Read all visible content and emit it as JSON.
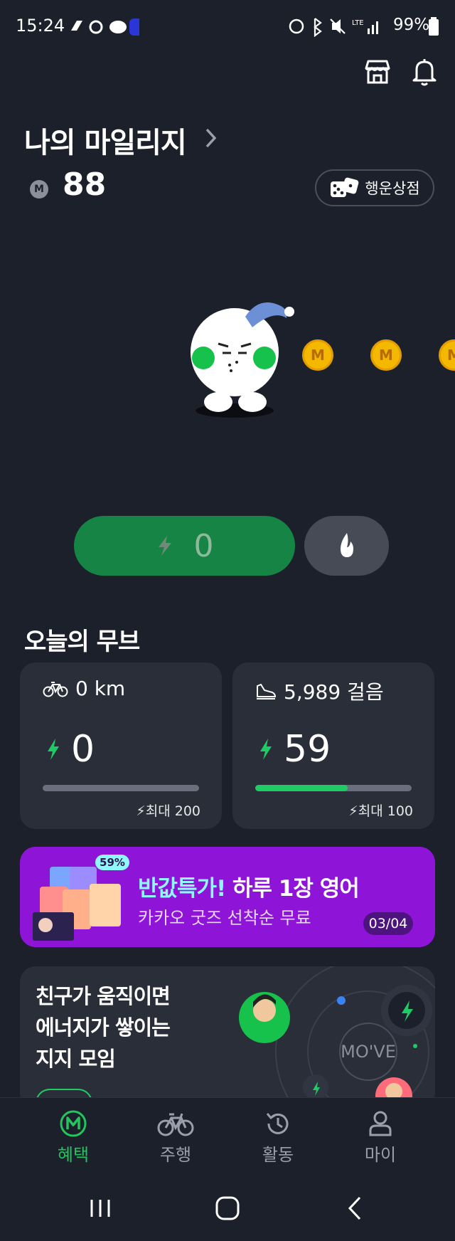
{
  "status_bar": {
    "time": "15:24",
    "battery": "99%",
    "network": "LTE"
  },
  "header": {
    "shop_icon": "store-icon",
    "bell_icon": "bell-icon"
  },
  "mileage": {
    "title": "나의 마일리지",
    "coin_symbol": "M",
    "value": "88",
    "lucky_shop_label": "행운상점"
  },
  "coins": [
    "M",
    "M",
    "M"
  ],
  "energy": {
    "value": "0"
  },
  "today": {
    "title": "오늘의 무브",
    "cards": [
      {
        "metric": "0 km",
        "icon": "bicycle-icon",
        "value": "0",
        "max": "최대 200",
        "progress": 0
      },
      {
        "metric": "5,989 걸음",
        "icon": "shoe-icon",
        "value": "59",
        "max": "최대 100",
        "progress": 0.59
      }
    ]
  },
  "banner": {
    "badge": "59%",
    "headline_highlight": "반값특가!",
    "headline_rest": " 하루 1장 영어",
    "subtext": "카카오 굿즈 선착순 무료",
    "page": "03/04"
  },
  "friends": {
    "line1": "친구가 움직이면",
    "line2": "에너지가 쌓이는",
    "line3": "지지 모임",
    "logo": "MO'VE"
  },
  "nav": {
    "items": [
      {
        "label": "혜택",
        "active": true
      },
      {
        "label": "주행",
        "active": false
      },
      {
        "label": "활동",
        "active": false
      },
      {
        "label": "마이",
        "active": false
      }
    ]
  },
  "colors": {
    "background": "#1c202b",
    "accent_green": "#22c55e",
    "energy_pill": "#168445",
    "banner": "#8e14d8"
  }
}
